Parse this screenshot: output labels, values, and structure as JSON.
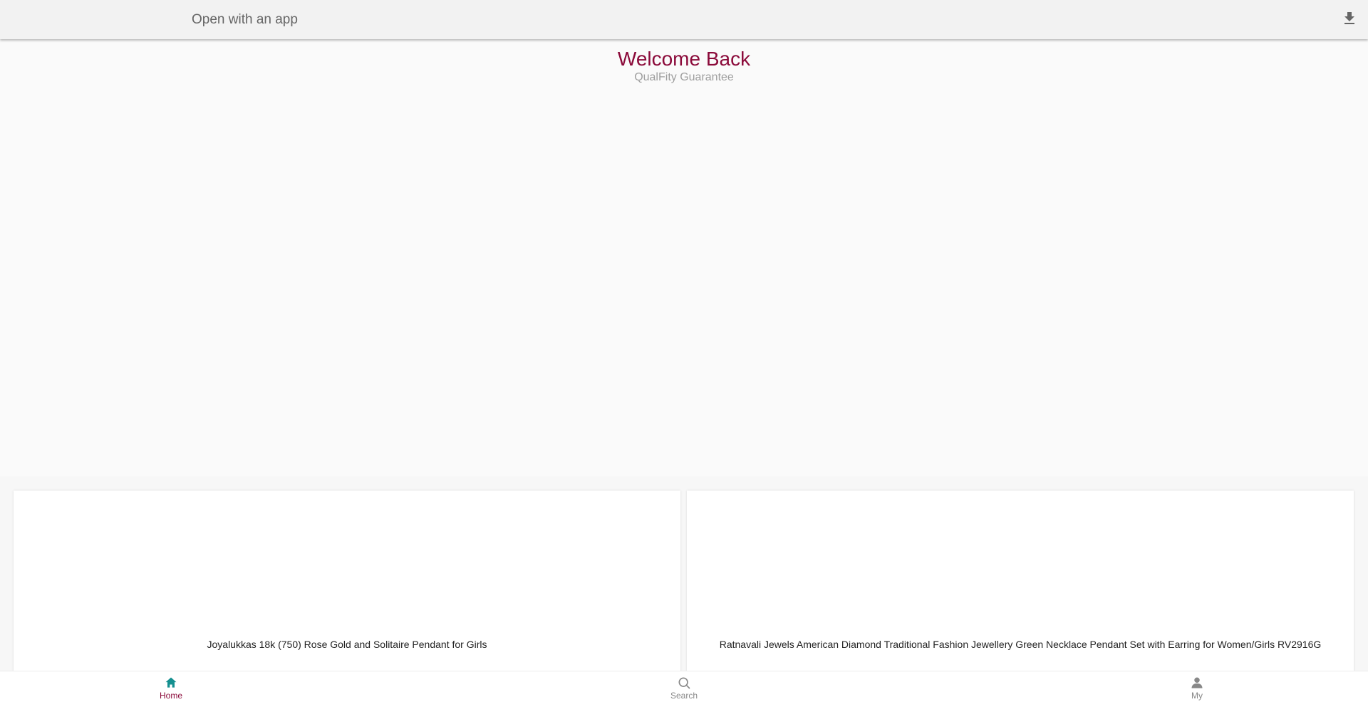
{
  "topbar": {
    "open_app_label": "Open with an app",
    "download_icon": "download-icon"
  },
  "hero": {
    "title": "Welcome Back",
    "subtitle": "QualFity Guarantee"
  },
  "products": [
    {
      "title": "Joyalukkas 18k (750) Rose Gold and Solitaire Pendant for Girls"
    },
    {
      "title": "Ratnavali Jewels American Diamond Traditional Fashion Jewellery Green Necklace Pendant Set with Earring for Women/Girls RV2916G"
    }
  ],
  "bottom_nav": {
    "items": [
      {
        "label": "Home",
        "icon": "home-icon",
        "active": true
      },
      {
        "label": "Search",
        "icon": "search-icon",
        "active": false
      },
      {
        "label": "My",
        "icon": "user-icon",
        "active": false
      }
    ]
  },
  "colors": {
    "brand": "#8b0a3a",
    "home_icon": "#149090",
    "inactive": "#888888"
  }
}
